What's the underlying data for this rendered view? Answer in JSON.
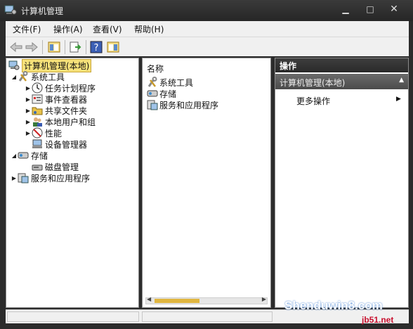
{
  "window": {
    "title": "计算机管理",
    "controls": {
      "minimize": "▁",
      "maximize": "□",
      "close": "✕"
    }
  },
  "menubar": {
    "items": [
      "文件(F)",
      "操作(A)",
      "查看(V)",
      "帮助(H)"
    ]
  },
  "toolbar": {
    "buttons": [
      "back-arrow-icon",
      "forward-arrow-icon",
      "show-hide-tree-icon",
      "export-list-icon",
      "help-icon",
      "show-hide-action-pane-icon"
    ]
  },
  "tree": {
    "root": "计算机管理(本地)",
    "items": [
      {
        "label": "系统工具",
        "level": 1,
        "expanded": true
      },
      {
        "label": "任务计划程序",
        "level": 2,
        "expanded": false
      },
      {
        "label": "事件查看器",
        "level": 2,
        "expanded": false
      },
      {
        "label": "共享文件夹",
        "level": 2,
        "expanded": false
      },
      {
        "label": "本地用户和组",
        "level": 2,
        "expanded": false
      },
      {
        "label": "性能",
        "level": 2,
        "expanded": false
      },
      {
        "label": "设备管理器",
        "level": 2,
        "expanded": null
      },
      {
        "label": "存储",
        "level": 1,
        "expanded": true
      },
      {
        "label": "磁盘管理",
        "level": 2,
        "expanded": null
      },
      {
        "label": "服务和应用程序",
        "level": 1,
        "expanded": false
      }
    ]
  },
  "list": {
    "header": "名称",
    "items": [
      "系统工具",
      "存储",
      "服务和应用程序"
    ]
  },
  "actions": {
    "title": "操作",
    "section": "计算机管理(本地)",
    "link": "更多操作"
  },
  "watermark": {
    "main": "Shenduwin8.com",
    "sub": "jb51.net"
  },
  "colors": {
    "selection": "#f7e27a",
    "scroll_thumb": "#e0b640",
    "action_header": "#333333"
  }
}
